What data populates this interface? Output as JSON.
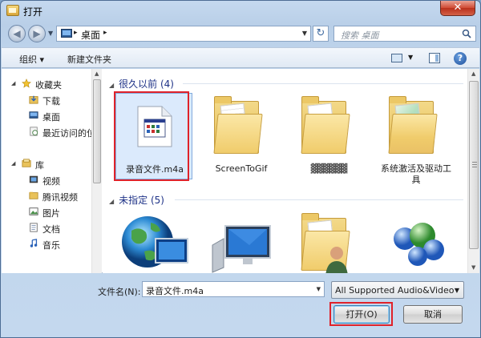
{
  "window": {
    "title": "打开",
    "close_glyph": "✕"
  },
  "address": {
    "location": "桌面",
    "sep": "▸",
    "search_placeholder": "搜索 桌面"
  },
  "toolbar": {
    "organize": "组织 ▾",
    "new_folder": "新建文件夹",
    "help": "?"
  },
  "nav": {
    "items": [
      {
        "label": "收藏夹",
        "icon": "star-icon"
      },
      {
        "label": "下载",
        "icon": "download-folder-icon"
      },
      {
        "label": "桌面",
        "icon": "desktop-icon"
      },
      {
        "label": "最近访问的位",
        "icon": "recent-places-icon"
      },
      {
        "label": "库",
        "icon": "library-icon"
      },
      {
        "label": "视频",
        "icon": "video-icon"
      },
      {
        "label": "腾讯视频",
        "icon": "folder-icon"
      },
      {
        "label": "图片",
        "icon": "pictures-icon"
      },
      {
        "label": "文档",
        "icon": "documents-icon"
      },
      {
        "label": "音乐",
        "icon": "music-icon"
      }
    ]
  },
  "groups": [
    {
      "title": "很久以前 (4)"
    },
    {
      "title": "未指定 (5)"
    }
  ],
  "files": [
    {
      "name": "录音文件.m4a",
      "icon": "audio-file-icon",
      "selected": true
    },
    {
      "name": "ScreenToGif",
      "icon": "folder-icon"
    },
    {
      "name": "▓▓▓▓▓▓",
      "icon": "folder-icon"
    },
    {
      "name": "系统激活及驱动工具",
      "icon": "folder-icon"
    },
    {
      "name": "",
      "icon": "network-globe-icon"
    },
    {
      "name": "",
      "icon": "computer-icon"
    },
    {
      "name": "",
      "icon": "user-folder-icon"
    },
    {
      "name": "",
      "icon": "network-spheres-icon"
    }
  ],
  "bottom": {
    "filename_label": "文件名(N):",
    "filename_value": "录音文件.m4a",
    "filetype": "All Supported Audio&Video",
    "open": "打开(O)",
    "cancel": "取消"
  },
  "colors": {
    "highlight": "#e0222a",
    "selection": "#dbeafc",
    "group_header": "#1e3287"
  }
}
